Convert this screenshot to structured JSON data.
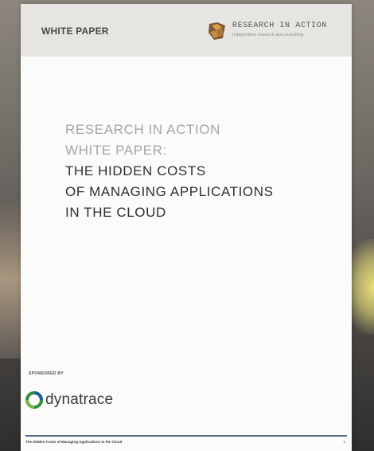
{
  "document": {
    "header": {
      "label": "WHITE PAPER",
      "brand": {
        "name": "RESEARCH IN ACTION",
        "tagline": "Independent research and consulting",
        "icon": "research-in-action-logo-icon"
      }
    },
    "title": {
      "line1": "RESEARCH IN ACTION",
      "line2": "WHITE PAPER:",
      "line3": "THE HIDDEN COSTS",
      "line4": "OF MANAGING APPLICATIONS",
      "line5": "IN THE CLOUD"
    },
    "sponsor": {
      "label": "SPONSORED BY",
      "name": "dynatrace",
      "icon": "dynatrace-logo-icon"
    },
    "footer": {
      "text": "The Hidden Costs of Managing Applications in the Cloud",
      "page": "1"
    },
    "colors": {
      "header_band": "#e6e5e2",
      "title_light": "#a6a5a3",
      "title_dark": "#2f2f2f",
      "footer_rule": "#5a6e8a"
    }
  }
}
